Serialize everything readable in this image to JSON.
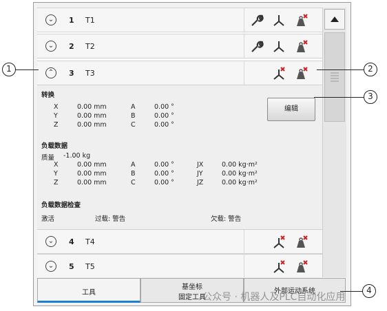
{
  "tools": [
    {
      "num": "1",
      "name": "T1"
    },
    {
      "num": "2",
      "name": "T2"
    },
    {
      "num": "3",
      "name": "T3"
    },
    {
      "num": "4",
      "name": "T4"
    },
    {
      "num": "5",
      "name": "T5"
    }
  ],
  "detail": {
    "transform_title": "转换",
    "rows": [
      {
        "axis": "X",
        "val": "0.00 mm",
        "rot": "A",
        "rval": "0.00 °"
      },
      {
        "axis": "Y",
        "val": "0.00 mm",
        "rot": "B",
        "rval": "0.00 °"
      },
      {
        "axis": "Z",
        "val": "0.00 mm",
        "rot": "C",
        "rval": "0.00 °"
      }
    ],
    "edit_label": "编辑",
    "load_title": "负载数据",
    "mass_label": "质量",
    "mass_value": "-1.00 kg",
    "load_rows": [
      {
        "axis": "X",
        "val": "0.00 mm",
        "rot": "A",
        "rval": "0.00 °",
        "j": "JX",
        "jval": "0.00 kg·m²"
      },
      {
        "axis": "Y",
        "val": "0.00 mm",
        "rot": "B",
        "rval": "0.00 °",
        "j": "JY",
        "jval": "0.00 kg·m²"
      },
      {
        "axis": "Z",
        "val": "0.00 mm",
        "rot": "C",
        "rval": "0.00 °",
        "j": "JZ",
        "jval": "0.00 kg·m²"
      }
    ],
    "check_title": "负载数据检查",
    "active_label": "激活",
    "overload_label": "过载: 警告",
    "underload_label": "欠载: 警告"
  },
  "tabs": {
    "tool": "工具",
    "base_line1": "基坐标",
    "base_line2": "固定工具",
    "external": "外部运动系统"
  },
  "callouts": [
    "1",
    "2",
    "3",
    "4"
  ],
  "watermark": "公众号 · 机器人及PLC自动化应用",
  "colors": {
    "accent": "#1e7fd0",
    "warn_x": "#d02020"
  }
}
